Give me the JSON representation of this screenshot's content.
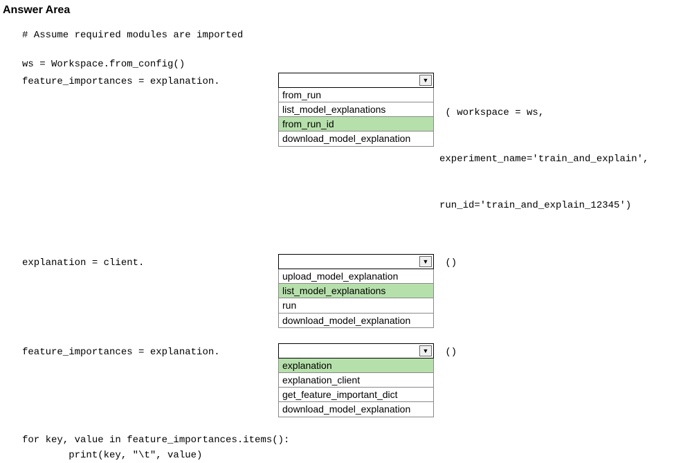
{
  "title": "Answer Area",
  "code": {
    "comment": "# Assume required modules are imported",
    "ws_line": "ws = Workspace.from_config()",
    "fi_eq_exp": "feature_importances = explanation.",
    "exp_eq_client": "explanation = client.",
    "right1_l1": " ( workspace = ws,",
    "right1_l2": "experiment_name='train_and_explain',",
    "right1_l3": "run_id='train_and_explain_12345')",
    "paren_call": " ()",
    "for_line": "for key, value in feature_importances.items():",
    "print_line": "        print(key, \"\\t\", value)"
  },
  "dd1": {
    "selected": "",
    "options": [
      "from_run",
      "list_model_explanations",
      "from_run_id",
      "download_model_explanation"
    ],
    "highlighted_index": 2
  },
  "dd2": {
    "selected": "",
    "options": [
      "upload_model_explanation",
      "list_model_explanations",
      "run",
      "download_model_explanation"
    ],
    "highlighted_index": 1
  },
  "dd3": {
    "selected": "",
    "options": [
      "explanation",
      "explanation_client",
      "get_feature_important_dict",
      "download_model_explanation"
    ],
    "highlighted_index": 0
  }
}
